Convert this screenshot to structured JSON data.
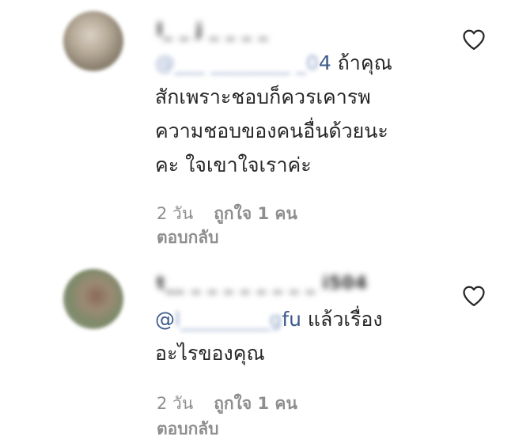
{
  "comments": [
    {
      "username": "l_ _ j _ _ _ _",
      "mention_blurred": "@___ ________ _0",
      "mention_visible": "4",
      "text_line1": " ถ้าคุณ",
      "text_line2": "สักเพราะชอบก็ควรเคารพ",
      "text_line3": "ความชอบของคนอื่นด้วยนะ",
      "text_line4": "คะ ใจเขาใจเราค่ะ",
      "time": "2 วัน",
      "likes": "ถูกใจ 1 คน",
      "reply": "ตอบกลับ",
      "like_icon": "heart-outline-icon"
    },
    {
      "username": "t__ _ _ _ _ _ _ _ _ i504",
      "mention_prefix": "@",
      "mention_blurred": "l_________g",
      "mention_visible": "fu",
      "text_line1": " แล้วเรื่อง",
      "text_line2": "อะไรของคุณ",
      "time": "2 วัน",
      "likes": "ถูกใจ 1 คน",
      "reply": "ตอบกลับ",
      "like_icon": "heart-outline-icon"
    }
  ]
}
